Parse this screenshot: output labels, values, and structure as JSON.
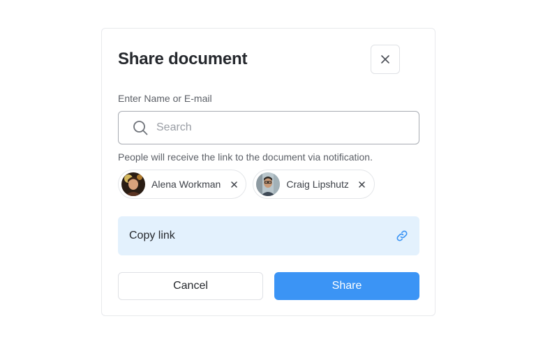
{
  "dialog": {
    "title": "Share document",
    "close_icon": "close-icon"
  },
  "search": {
    "label": "Enter Name or E-mail",
    "placeholder": "Search",
    "value": "",
    "icon": "search-icon"
  },
  "hint": "People will receive the link to the document via notification.",
  "people": [
    {
      "name": "Alena Workman",
      "remove_icon": "close-icon"
    },
    {
      "name": "Craig Lipshutz",
      "remove_icon": "close-icon"
    }
  ],
  "copy_link": {
    "label": "Copy link",
    "icon": "link-icon"
  },
  "actions": {
    "cancel_label": "Cancel",
    "share_label": "Share"
  },
  "colors": {
    "accent": "#3b94f5",
    "copy_link_bg": "#e3f1fd",
    "link_icon": "#3b94f5"
  }
}
